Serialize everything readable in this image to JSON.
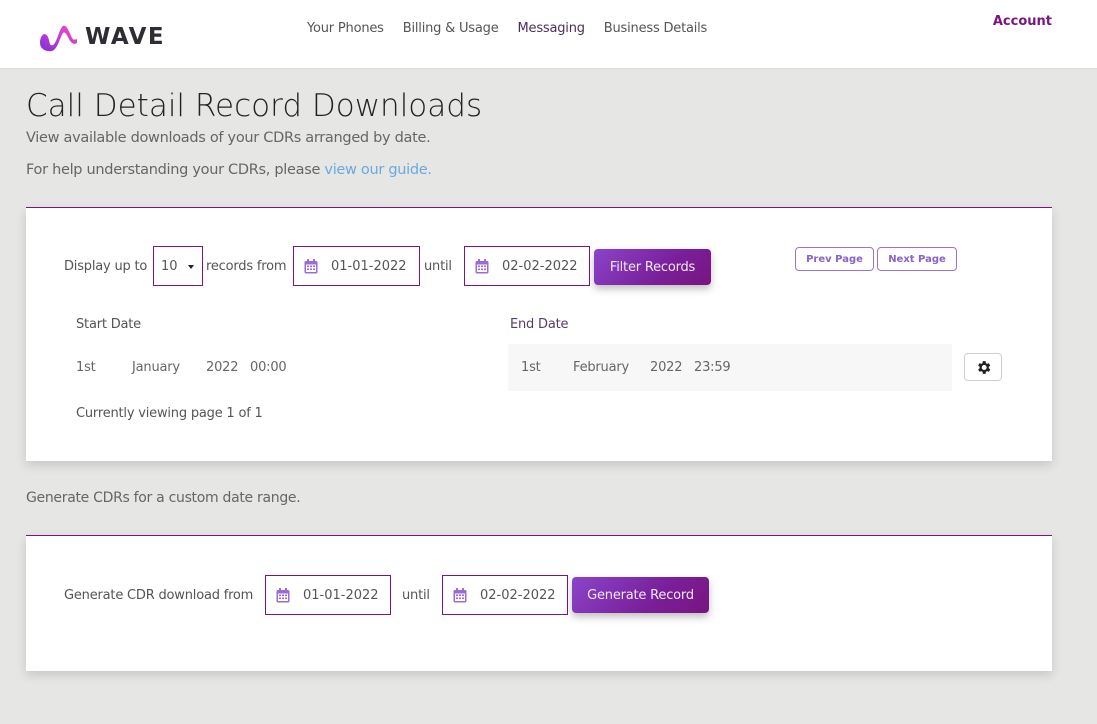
{
  "brand": {
    "name": "WAVE",
    "accent": "#7a1580",
    "link": "#6aa9e0",
    "button_gradient": [
      "#8a45c9",
      "#78157f"
    ]
  },
  "nav": {
    "items": [
      {
        "label": "Your Phones"
      },
      {
        "label": "Billing & Usage"
      },
      {
        "label": "Messaging"
      },
      {
        "label": "Business Details"
      }
    ],
    "account": "Account"
  },
  "page": {
    "title": "Call Detail Record Downloads",
    "subtitle": "View available downloads of your CDRs arranged by date.",
    "help_prefix": "For help understanding your CDRs, please ",
    "help_link": "view our guide."
  },
  "filter": {
    "display_label": "Display up to",
    "records_count": "10",
    "records_from_label": "records from",
    "from_date": "01-01-2022",
    "until_label": "until",
    "to_date": "02-02-2022",
    "filter_button": "Filter Records",
    "prev_button": "Prev Page",
    "next_button": "Next Page"
  },
  "records": {
    "start_header": "Start Date",
    "end_header": "End Date",
    "rows": [
      {
        "start": {
          "day": "1st",
          "month": "January",
          "year": "2022",
          "time": "00:00"
        },
        "end": {
          "day": "1st",
          "month": "February",
          "year": "2022",
          "time": "23:59"
        },
        "action_icon": "gear-icon"
      }
    ],
    "pagination": "Currently viewing page 1 of 1"
  },
  "generate": {
    "intro": "Generate CDRs for a custom date range.",
    "from_label": "Generate CDR download from",
    "from_date": "01-01-2022",
    "until_label": "until",
    "to_date": "02-02-2022",
    "button": "Generate Record"
  }
}
